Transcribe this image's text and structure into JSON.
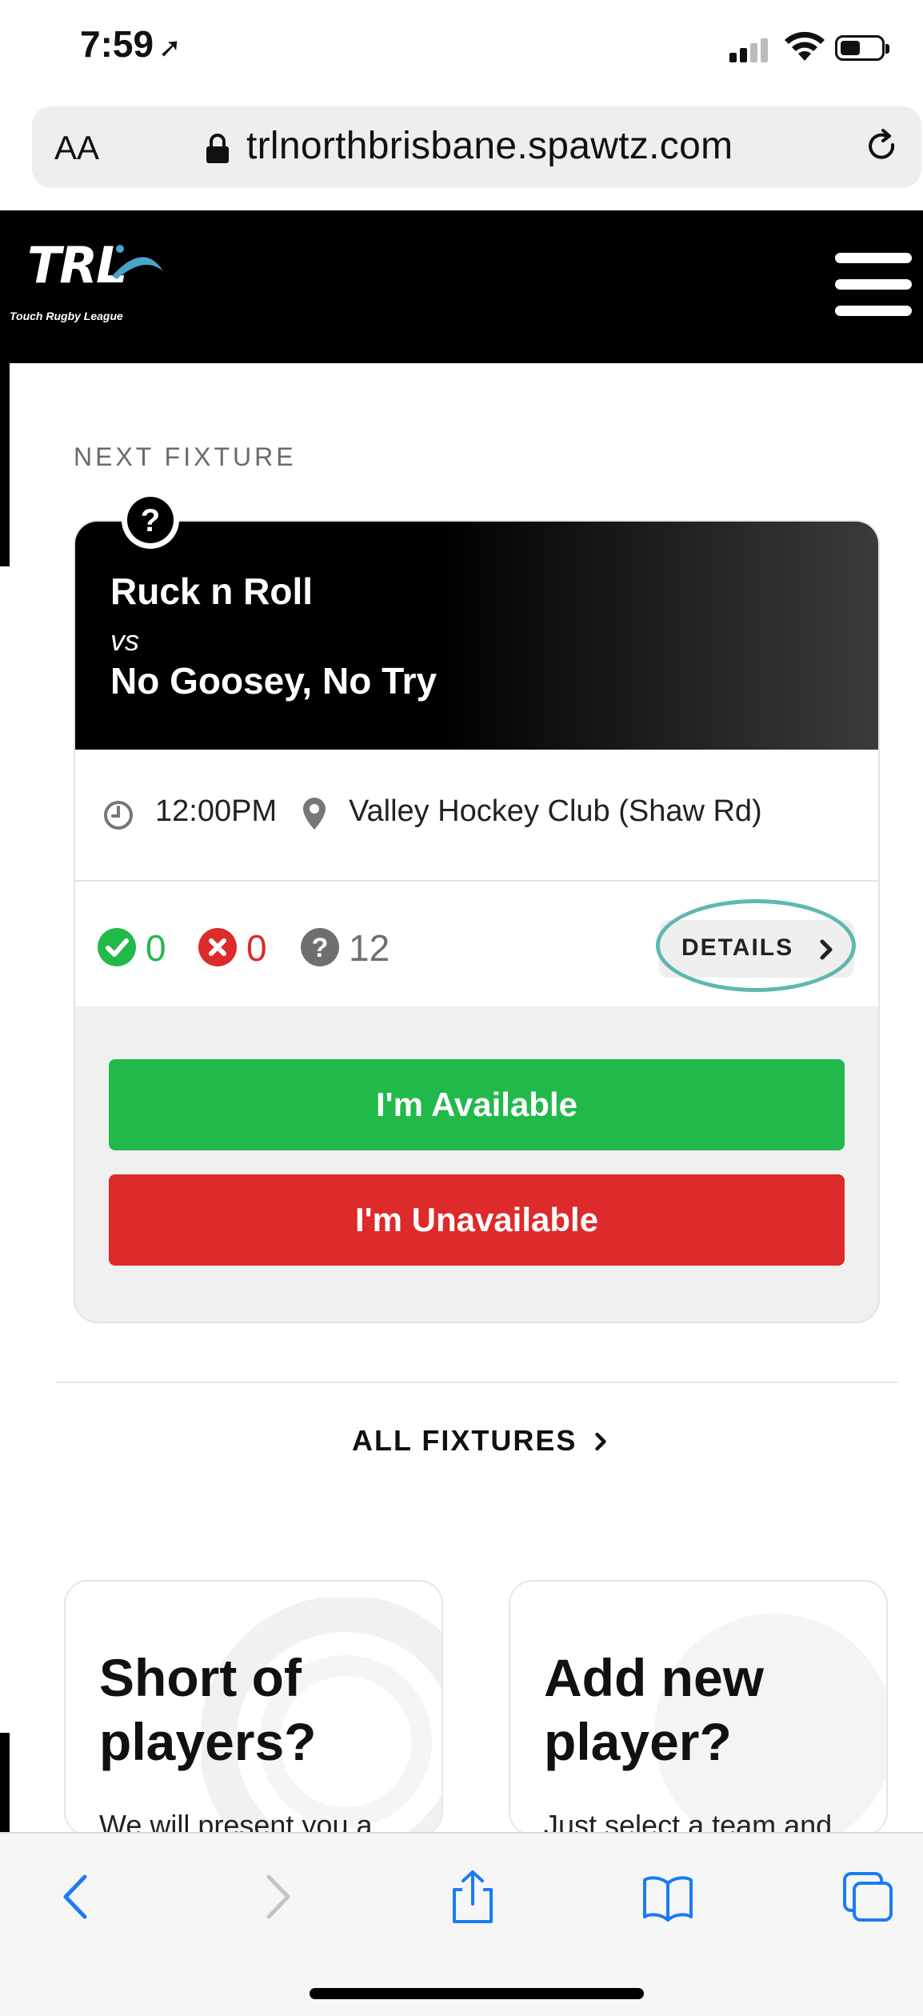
{
  "status_bar": {
    "time": "7:59",
    "location_arrow": "location-arrow-icon"
  },
  "browser": {
    "text_size_label": "AA",
    "url": "trlnorthbrisbane.spawtz.com"
  },
  "header": {
    "logo_text": "TRL",
    "logo_subtitle": "Touch Rugby League"
  },
  "next_fixture": {
    "section_label": "NEXT FIXTURE",
    "team_home": "Ruck n Roll",
    "vs_label": "vs",
    "team_away": "No Goosey, No Try",
    "time": "12:00PM",
    "venue": "Valley Hockey Club (Shaw Rd)",
    "available_count": "0",
    "unavailable_count": "0",
    "unknown_count": "12",
    "details_label": "DETAILS",
    "available_button": "I'm Available",
    "unavailable_button": "I'm Unavailable"
  },
  "all_fixtures_label": "ALL FIXTURES",
  "promos": [
    {
      "title_line1": "Short of",
      "title_line2": "players?",
      "subtitle": "We will present you a"
    },
    {
      "title_line1": "Add new",
      "title_line2": "player?",
      "subtitle": "Just select a team and"
    }
  ],
  "colors": {
    "available_green": "#22b94b",
    "unavailable_red": "#dd2a2a",
    "unknown_gray": "#6f6f6f",
    "safari_blue": "#1a7cf5",
    "highlight_ring": "#5fb7b0"
  }
}
